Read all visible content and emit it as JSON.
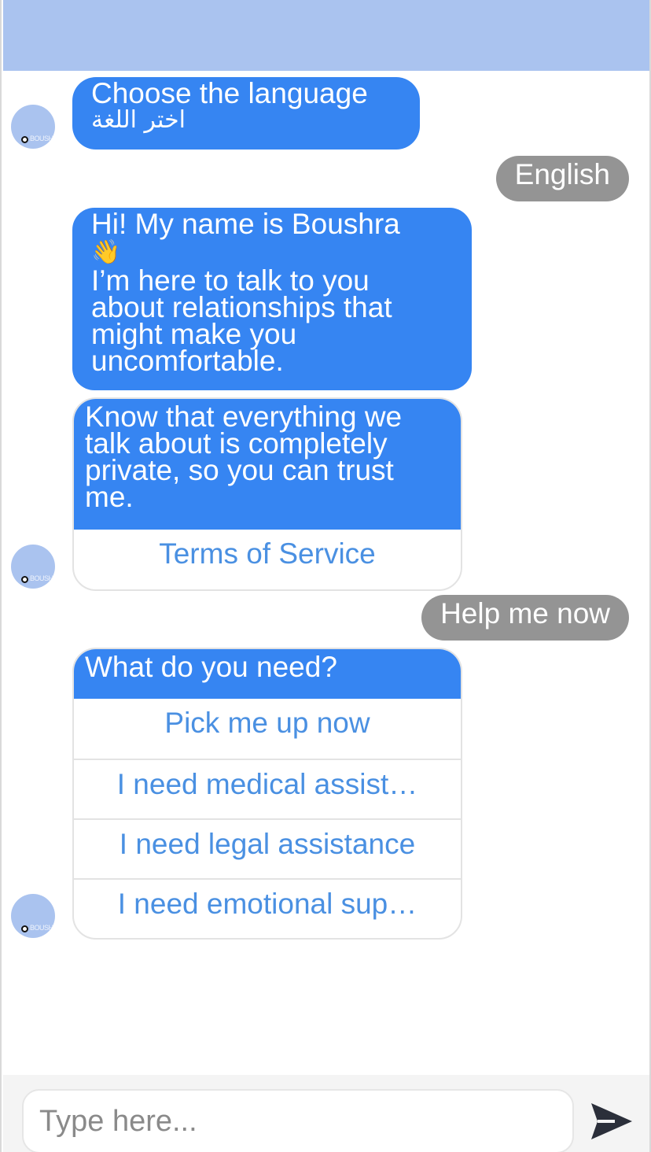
{
  "messages": {
    "language_prompt": {
      "line1": "Choose the language",
      "line2": "اختر اللغة"
    },
    "user_english": "English",
    "intro": {
      "line1": "Hi! My name is Boushra",
      "emoji": "👋",
      "line2": "I’m here to talk to you",
      "line3": "about relationships that",
      "line4": "might make you",
      "line5": "uncomfortable."
    },
    "privacy": {
      "line1": "Know that everything we",
      "line2": "talk about is completely",
      "line3": "private, so you can trust",
      "line4": "me.",
      "terms_button": "Terms of Service"
    },
    "user_help": "Help me now",
    "needs": {
      "question": "What do you need?",
      "options": [
        "Pick me up now",
        "I need medical assist…",
        "I need legal assistance",
        "I need emotional sup…"
      ]
    }
  },
  "avatar": {
    "watermark": "BOUSHRA"
  },
  "composer": {
    "placeholder": "Type here...",
    "value": ""
  },
  "icons": {
    "send": "send-icon",
    "wave": "waving-hand-icon",
    "avatar": "bot-avatar"
  },
  "colors": {
    "header": "#aac3ef",
    "bot_bubble": "#3685f2",
    "user_bubble": "#949494",
    "option_text": "#4a90e2"
  }
}
